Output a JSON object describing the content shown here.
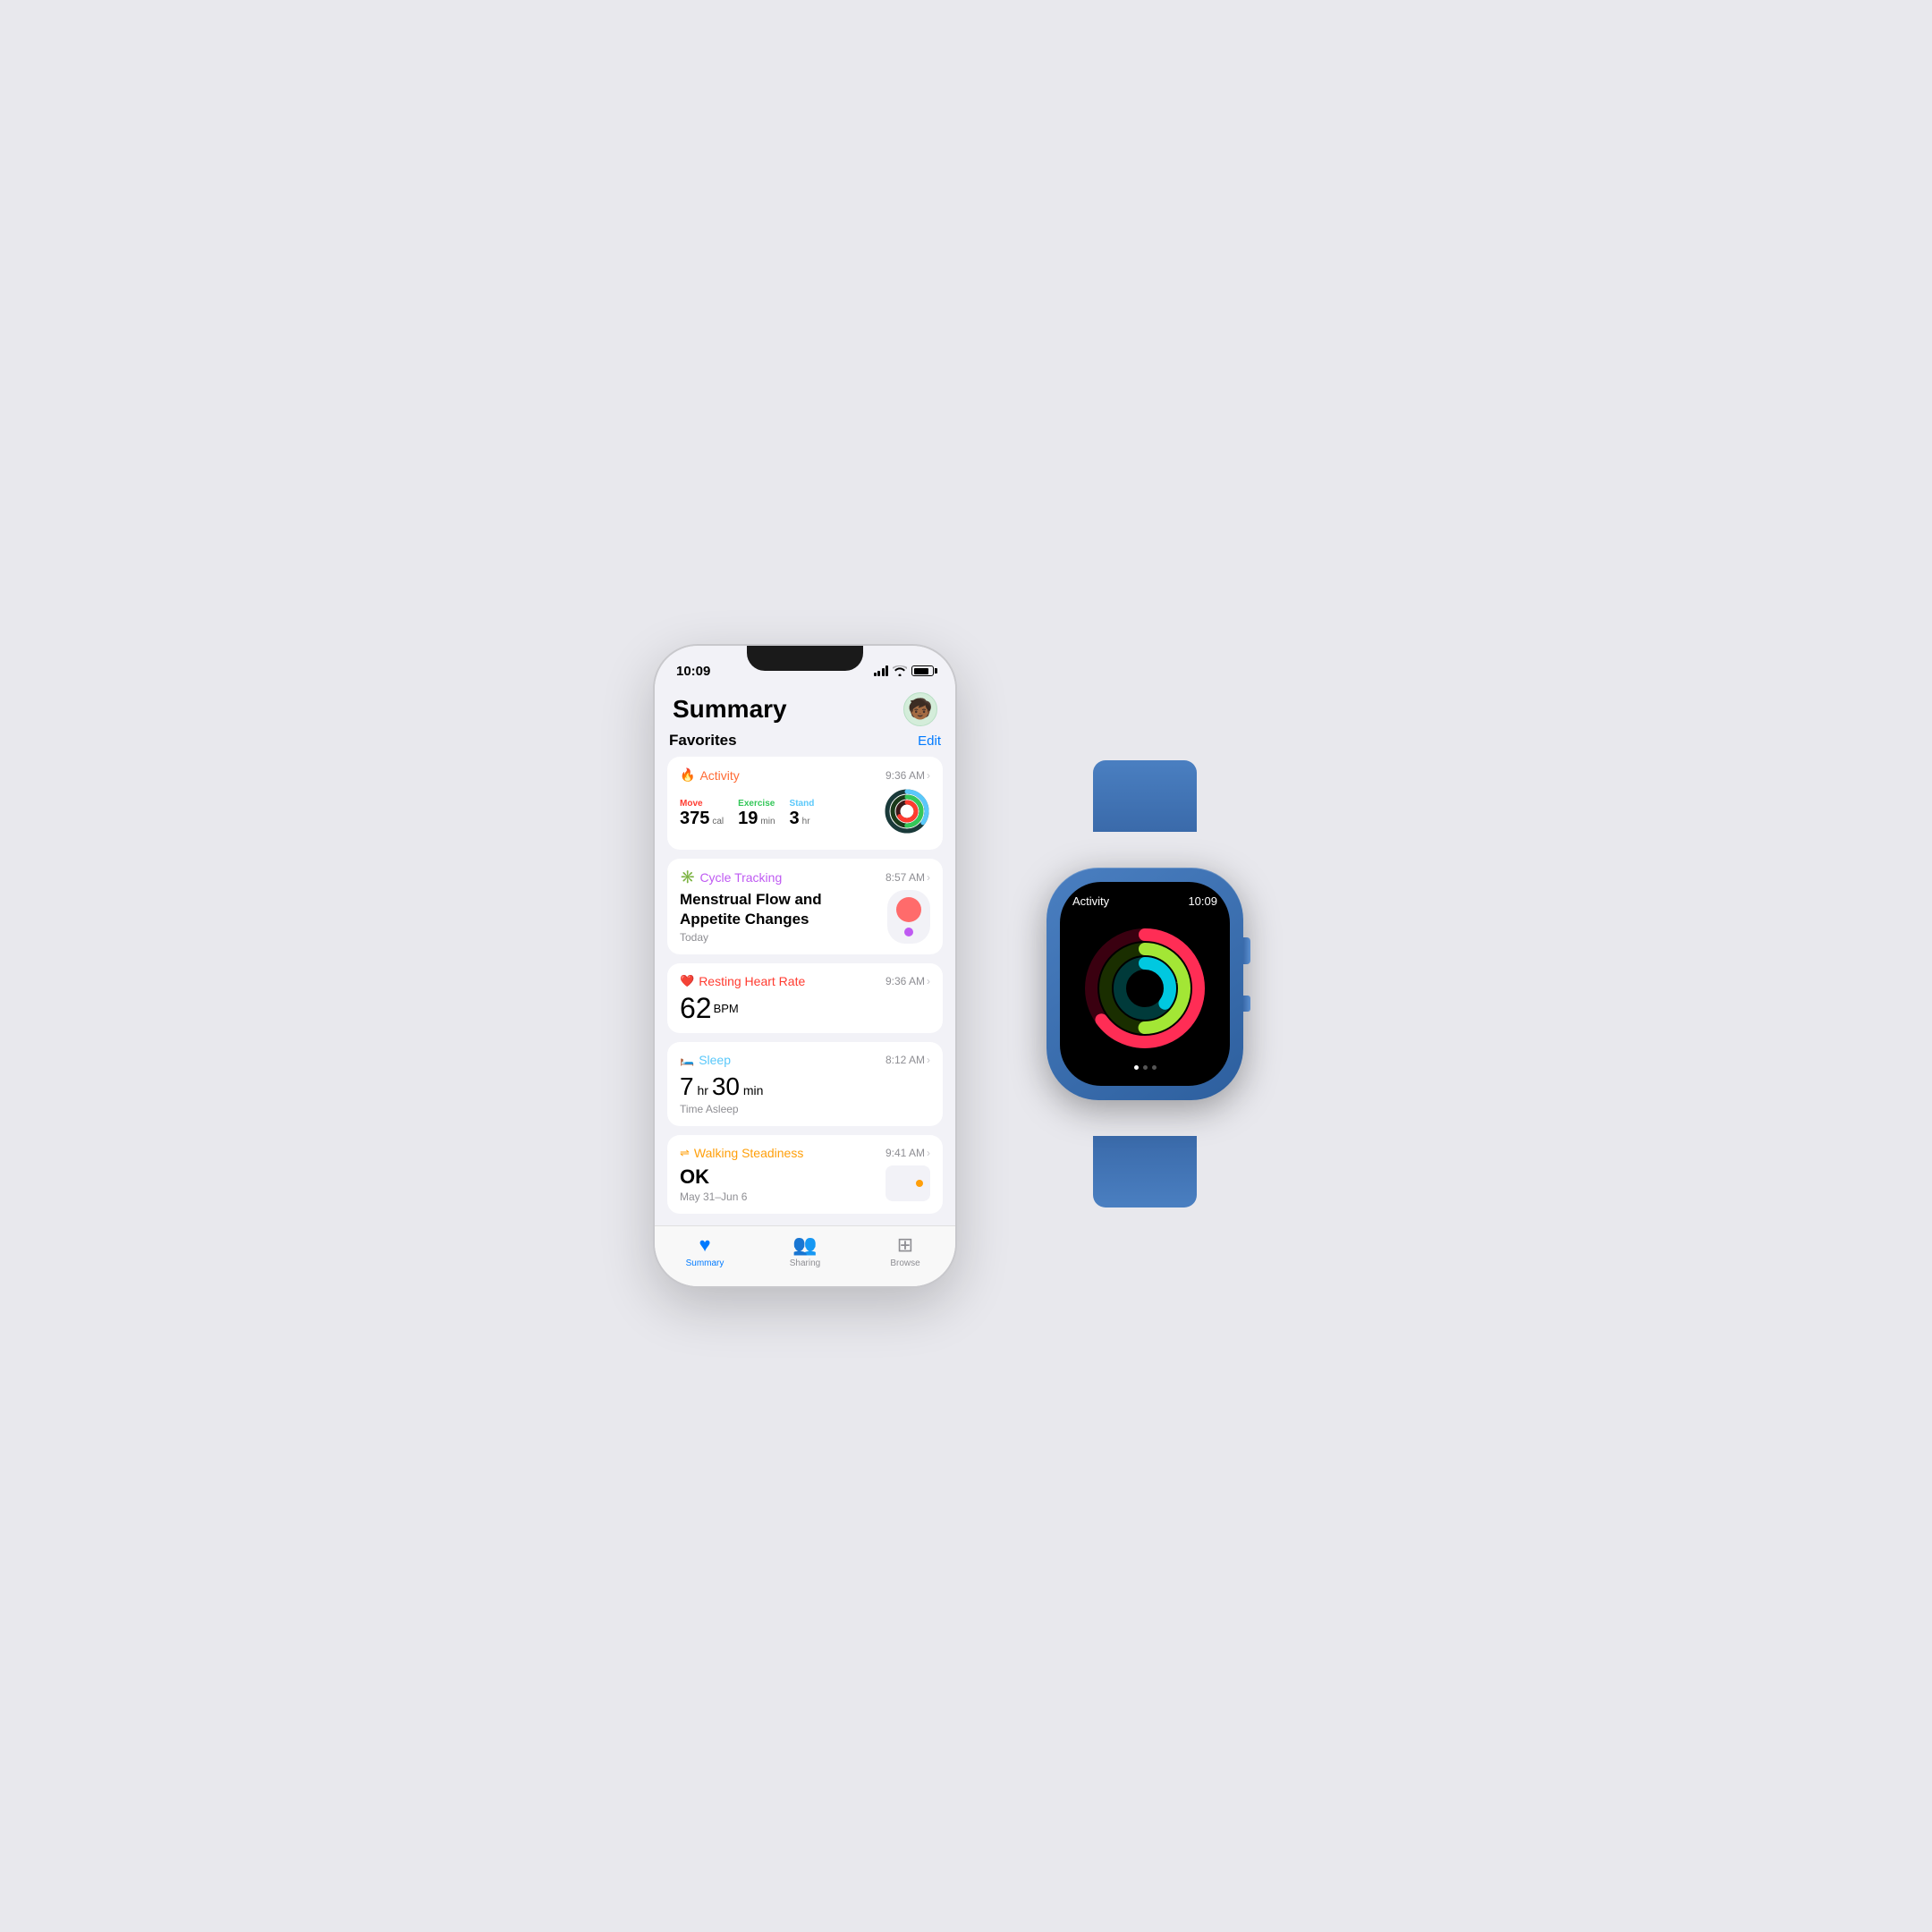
{
  "scene": {
    "background": "#e8e8ed"
  },
  "iphone": {
    "status_bar": {
      "time": "10:09",
      "signal": "4 bars",
      "wifi": true,
      "battery": "full"
    },
    "app": {
      "title": "Summary",
      "avatar_emoji": "🧒🏾"
    },
    "favorites": {
      "label": "Favorites",
      "edit_label": "Edit"
    },
    "cards": {
      "activity": {
        "title": "Activity",
        "time": "9:36 AM",
        "move_label": "Move",
        "move_value": "375",
        "move_unit": "cal",
        "exercise_label": "Exercise",
        "exercise_value": "19",
        "exercise_unit": "min",
        "stand_label": "Stand",
        "stand_value": "3",
        "stand_unit": "hr"
      },
      "cycle_tracking": {
        "title": "Cycle Tracking",
        "time": "8:57 AM",
        "main_text": "Menstrual Flow and Appetite Changes",
        "sub_text": "Today"
      },
      "resting_heart_rate": {
        "title": "Resting Heart Rate",
        "time": "9:36 AM",
        "value": "62",
        "unit": "BPM"
      },
      "sleep": {
        "title": "Sleep",
        "time": "8:12 AM",
        "hours": "7",
        "minutes": "30",
        "sub": "Time Asleep"
      },
      "walking_steadiness": {
        "title": "Walking Steadiness",
        "time": "9:41 AM",
        "value": "OK",
        "date_range": "May 31–Jun 6"
      }
    },
    "tab_bar": {
      "summary_label": "Summary",
      "sharing_label": "Sharing",
      "browse_label": "Browse"
    }
  },
  "watch": {
    "app_title": "Activity",
    "time": "10:09",
    "dots": [
      {
        "active": true
      },
      {
        "active": false
      },
      {
        "active": false
      }
    ],
    "rings": {
      "move": {
        "color": "#ff2d55",
        "progress": 0.65
      },
      "exercise": {
        "color": "#a3e635",
        "progress": 0.5
      },
      "stand": {
        "color": "#00c8e0",
        "progress": 0.35
      }
    }
  }
}
